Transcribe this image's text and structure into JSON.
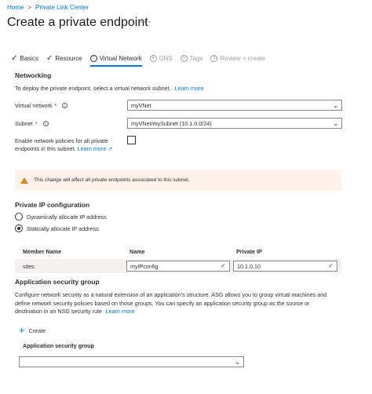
{
  "breadcrumb": {
    "home": "Home",
    "separator": ">",
    "parent": "Private Link Center"
  },
  "page": {
    "title": "Create a private endpoint",
    "more": "···"
  },
  "tabs": [
    {
      "label": "Basics",
      "state": "done"
    },
    {
      "label": "Resource",
      "state": "done"
    },
    {
      "label": "Virtual Network",
      "state": "active",
      "num": "!"
    },
    {
      "label": "DNS",
      "state": "disabled",
      "num": "4"
    },
    {
      "label": "Tags",
      "state": "disabled",
      "num": "5"
    },
    {
      "label": "Review + create",
      "state": "disabled",
      "num": "6"
    }
  ],
  "networking": {
    "heading": "Networking",
    "description": "To deploy the private endpoint, select a virtual network subnet.",
    "learn_more": "Learn more",
    "vnet_label": "Virtual network",
    "vnet_value": "myVNet",
    "subnet_label": "Subnet",
    "subnet_value": "myVNet/mySubnet (10.1.0.0/24)",
    "policy_label_1": "Enable network policies for all private",
    "policy_label_2": "endpoints in this subnet.",
    "policy_learn_more": "Learn more",
    "required_mark": "*",
    "info_glyph": "i"
  },
  "warning": {
    "text": "This change will affect all private endpoints associated to this subnet."
  },
  "private_ip": {
    "heading": "Private IP configuration",
    "option_dynamic": "Dynamically allocate IP address",
    "option_static": "Statically allocate IP address",
    "selected": "static"
  },
  "ip_table": {
    "columns": [
      "Member Name",
      "Name",
      "Private IP"
    ],
    "rows": [
      {
        "member": "sites",
        "name": "myIPconfig",
        "ip": "10.1.0.10"
      }
    ]
  },
  "asg": {
    "heading": "Application security group",
    "description_1": "Configure network security as a natural extension of an application's structure. ASG allows you to group virtual machines and",
    "description_2": "define network security policies based on those groups. You can specify an application security group as the source or",
    "description_3": "destination in an NSG security rule",
    "learn_more": "Learn more",
    "create_label": "Create",
    "column_label": "Application security group",
    "select_value": ""
  },
  "colors": {
    "accent": "#0078d4",
    "warning_bg": "#fdf3ea",
    "warning_icon": "#d68a1c",
    "success": "#107c10"
  }
}
